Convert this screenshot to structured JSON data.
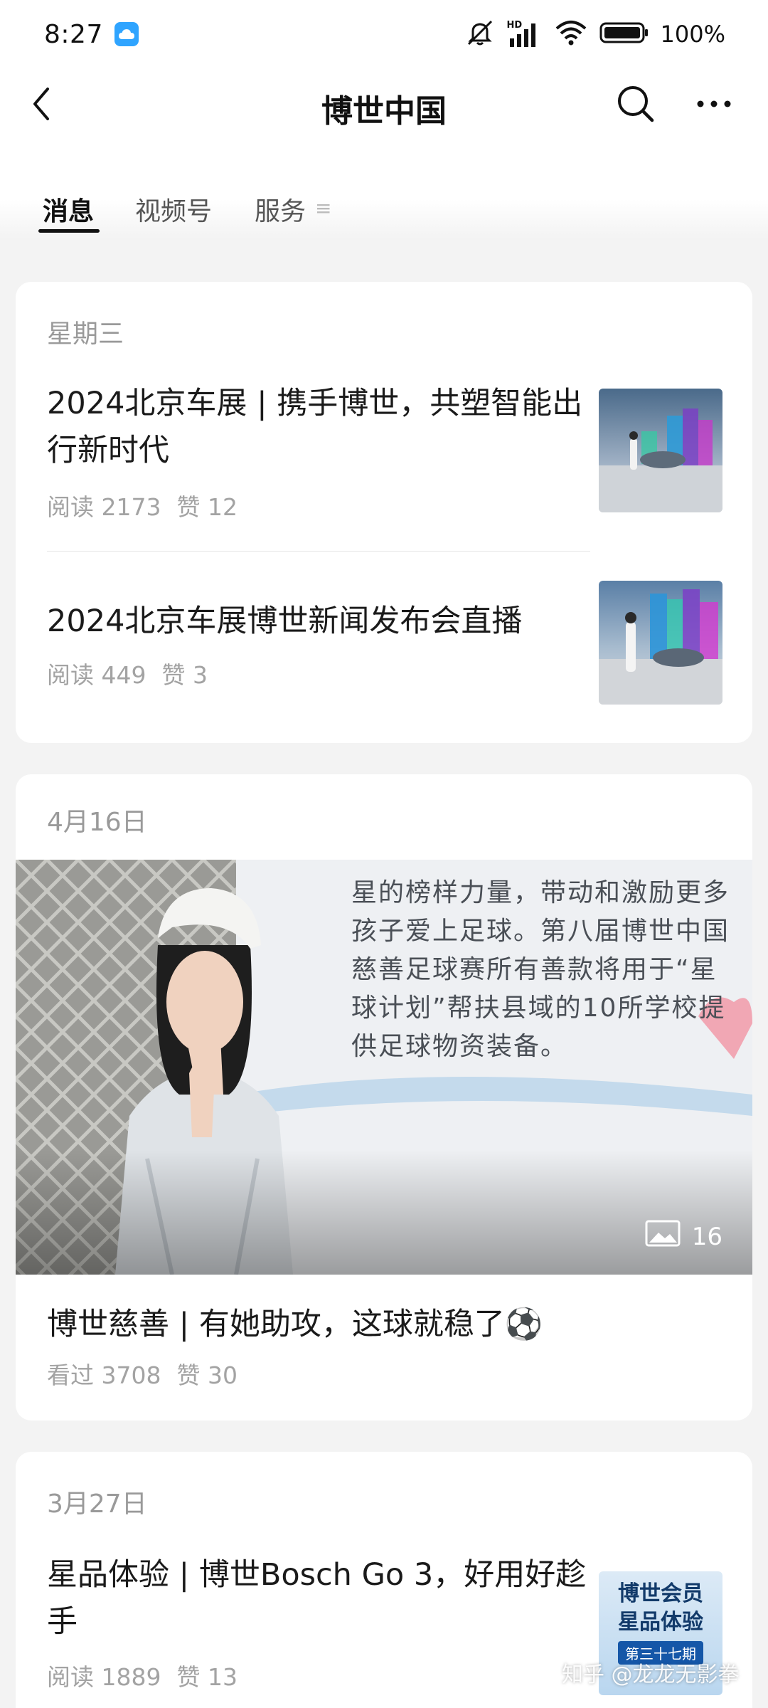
{
  "status_bar": {
    "time": "8:27",
    "network_label": "HD",
    "battery_text": "100%"
  },
  "navbar": {
    "title": "博世中国"
  },
  "tabs": [
    {
      "label": "消息"
    },
    {
      "label": "视频号"
    },
    {
      "label": "服务"
    }
  ],
  "cards": [
    {
      "date": "星期三",
      "articles": [
        {
          "title": "2024北京车展 | 携手博世，共塑智能出行新时代",
          "reads": "阅读 2173",
          "likes": "赞 12"
        },
        {
          "title": "2024北京车展博世新闻发布会直播",
          "reads": "阅读 449",
          "likes": "赞 3"
        }
      ]
    },
    {
      "date": "4月16日",
      "image_text": [
        "星的榜样力量，带动和激励更多",
        "孩子爱上足球。第八届博世中国",
        "慈善足球赛所有善款将用于“星",
        "球计划”帮扶县域的10所学校提",
        "供足球物资装备。"
      ],
      "image_count": "16",
      "title": "博世慈善 | 有她助攻，这球就稳了⚽",
      "reads": "看过 3708",
      "likes": "赞 30"
    },
    {
      "date": "3月27日",
      "title": "星品体验 | 博世Bosch Go 3，好用好趁手",
      "reads": "阅读 1889",
      "likes": "赞 13",
      "thumb_text": {
        "line1": "博世会员",
        "line2": "星品体验",
        "badge": "第三十七期"
      }
    }
  ],
  "watermark": "知乎 @龙龙无影拳",
  "colors": {
    "accent_blue": "#2fa4ff",
    "meta_gray": "#a3a3a3",
    "card_bg": "#ffffff",
    "page_bg": "#f3f3f3"
  }
}
